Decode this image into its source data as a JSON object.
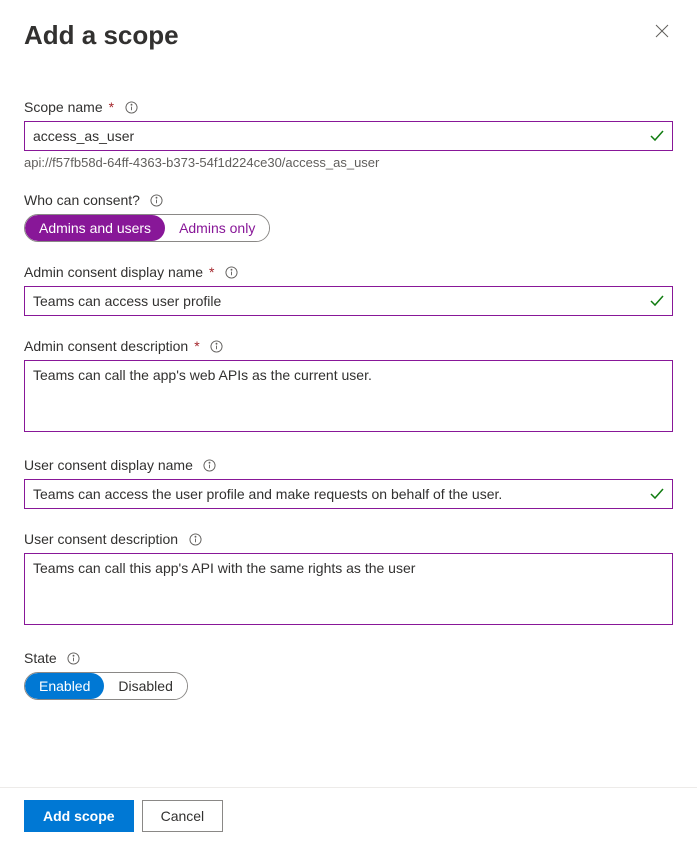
{
  "header": {
    "title": "Add a scope"
  },
  "scopeName": {
    "label": "Scope name",
    "required": "*",
    "value": "access_as_user",
    "hint": "api://f57fb58d-64ff-4363-b373-54f1d224ce30/access_as_user"
  },
  "consent": {
    "label": "Who can consent?",
    "opt1": "Admins and users",
    "opt2": "Admins only"
  },
  "adminDisplay": {
    "label": "Admin consent display name",
    "required": "*",
    "value": "Teams can access user profile"
  },
  "adminDesc": {
    "label": "Admin consent description",
    "required": "*",
    "value": "Teams can call the app's web APIs as the current user."
  },
  "userDisplay": {
    "label": "User consent display name",
    "value": "Teams can access the user profile and make requests on behalf of the user."
  },
  "userDesc": {
    "label": "User consent description",
    "value": "Teams can call this app's API with the same rights as the user"
  },
  "state": {
    "label": "State",
    "opt1": "Enabled",
    "opt2": "Disabled"
  },
  "footer": {
    "primary": "Add scope",
    "secondary": "Cancel"
  }
}
